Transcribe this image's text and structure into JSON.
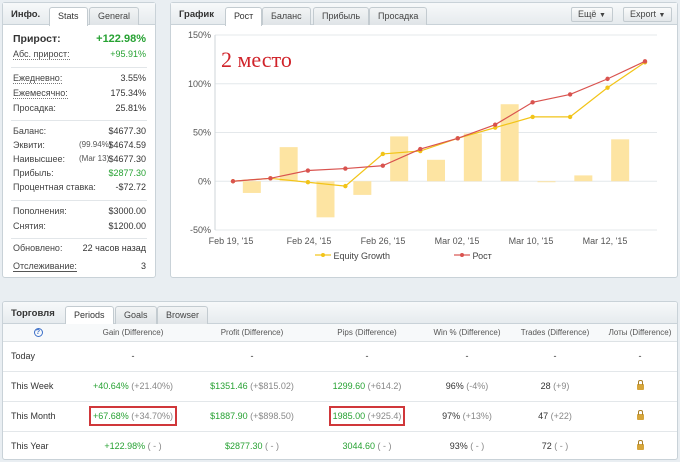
{
  "info": {
    "title": "Инфо.",
    "tabs": [
      "Stats",
      "General"
    ],
    "gain": {
      "label": "Прирост:",
      "value": "+122.98%"
    },
    "abs_gain": {
      "label": "Абс. прирост:",
      "value": "+95.91%"
    },
    "daily": {
      "label": "Ежедневно:",
      "value": "3.55%"
    },
    "monthly": {
      "label": "Ежемесячно:",
      "value": "175.34%"
    },
    "drawdown": {
      "label": "Просадка:",
      "value": "25.81%"
    },
    "balance": {
      "label": "Баланс:",
      "value": "$4677.30"
    },
    "equity": {
      "label": "Эквити:",
      "note": "(99.94%)",
      "value": "$4674.59"
    },
    "highest": {
      "label": "Наивысшее:",
      "note": "(Mar 13)",
      "value": "$4677.30"
    },
    "profit": {
      "label": "Прибыль:",
      "value": "$2877.30"
    },
    "interest": {
      "label": "Процентная ставка:",
      "value": "-$72.72"
    },
    "deposits": {
      "label": "Пополнения:",
      "value": "$3000.00"
    },
    "withdrawals": {
      "label": "Снятия:",
      "value": "$1200.00"
    },
    "updated": {
      "label": "Обновлено:",
      "value": "22 часов назад"
    },
    "tracking": {
      "label": "Отслеживание:",
      "value": "3"
    }
  },
  "chart_panel": {
    "title": "График",
    "tabs": [
      "Рост",
      "Баланс",
      "Прибыль",
      "Просадка"
    ],
    "more_label": "Ещё",
    "export_label": "Export",
    "annotation": "2 место"
  },
  "chart_data": {
    "type": "bar",
    "y_ticks": [
      "150%",
      "100%",
      "50%",
      "0%",
      "-50%"
    ],
    "ylim": [
      -50,
      150
    ],
    "x_ticks": [
      "Feb 19, '15",
      "Feb 24, '15",
      "Feb 26, '15",
      "Mar 02, '15",
      "Mar 10, '15",
      "Mar 12, '15"
    ],
    "bars": [
      -12,
      35,
      -37,
      -14,
      46,
      22,
      49,
      79,
      -1,
      6,
      43
    ],
    "series": [
      {
        "name": "Equity Growth",
        "color": "#f2c418",
        "values": [
          0,
          3,
          -1,
          -5,
          28,
          31,
          44,
          55,
          66,
          66,
          96,
          122
        ]
      },
      {
        "name": "Рост",
        "color": "#d9534f",
        "values": [
          0,
          3,
          11,
          13,
          16,
          33,
          44,
          58,
          81,
          89,
          105,
          123
        ]
      }
    ],
    "bar_color": "#fde4a2",
    "grid": true,
    "legend": "bottom"
  },
  "trading": {
    "title": "Торговля",
    "tabs": [
      "Periods",
      "Goals",
      "Browser"
    ],
    "headers": [
      "Gain (Difference)",
      "Profit (Difference)",
      "Pips (Difference)",
      "Win % (Difference)",
      "Trades (Difference)",
      "Лоты (Difference)"
    ],
    "rows": [
      {
        "period": "Today",
        "gain": "-",
        "gain_diff": "",
        "profit": "-",
        "profit_diff": "",
        "pips": "-",
        "pips_diff": "",
        "win": "-",
        "win_diff": "",
        "trades": "-",
        "trades_diff": "",
        "lots": "-"
      },
      {
        "period": "This Week",
        "gain": "+40.64%",
        "gain_diff": "(+21.40%)",
        "profit": "$1351.46",
        "profit_diff": "(+$815.02)",
        "pips": "1299.60",
        "pips_diff": "(+614.2)",
        "win": "96%",
        "win_diff": "(-4%)",
        "trades": "28",
        "trades_diff": "(+9)",
        "lots": ""
      },
      {
        "period": "This Month",
        "gain": "+67.68%",
        "gain_diff": "(+34.70%)",
        "profit": "$1887.90",
        "profit_diff": "(+$898.50)",
        "pips": "1985.00",
        "pips_diff": "(+925.4)",
        "win": "97%",
        "win_diff": "(+13%)",
        "trades": "47",
        "trades_diff": "(+22)",
        "lots": ""
      },
      {
        "period": "This Year",
        "gain": "+122.98%",
        "gain_diff": "( - )",
        "profit": "$2877.30",
        "profit_diff": "( - )",
        "pips": "3044.60",
        "pips_diff": "( - )",
        "win": "93%",
        "win_diff": "( - )",
        "trades": "72",
        "trades_diff": "( - )",
        "lots": ""
      }
    ]
  }
}
